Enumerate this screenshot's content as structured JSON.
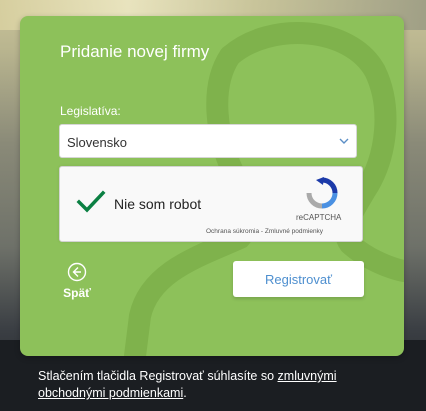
{
  "form": {
    "title": "Pridanie novej firmy",
    "legislation_label": "Legislatíva:",
    "legislation_value": "Slovensko",
    "register_label": "Registrovať",
    "back_label": "Späť"
  },
  "captcha": {
    "checkbox_label": "Nie som robot",
    "brand": "reCAPTCHA",
    "privacy_link": "Ochrana súkromia",
    "separator": " - ",
    "terms_link": "Zmluvné podmienky",
    "checked": true
  },
  "footer": {
    "text": "Stlačením tlačidla Registrovať súhlasíte so ",
    "terms_link": "zmluvnými obchodnými podmienkami",
    "end": "."
  },
  "colors": {
    "card": "#8dc15a",
    "check": "#0b8043",
    "button_text": "#4e8fcf"
  }
}
